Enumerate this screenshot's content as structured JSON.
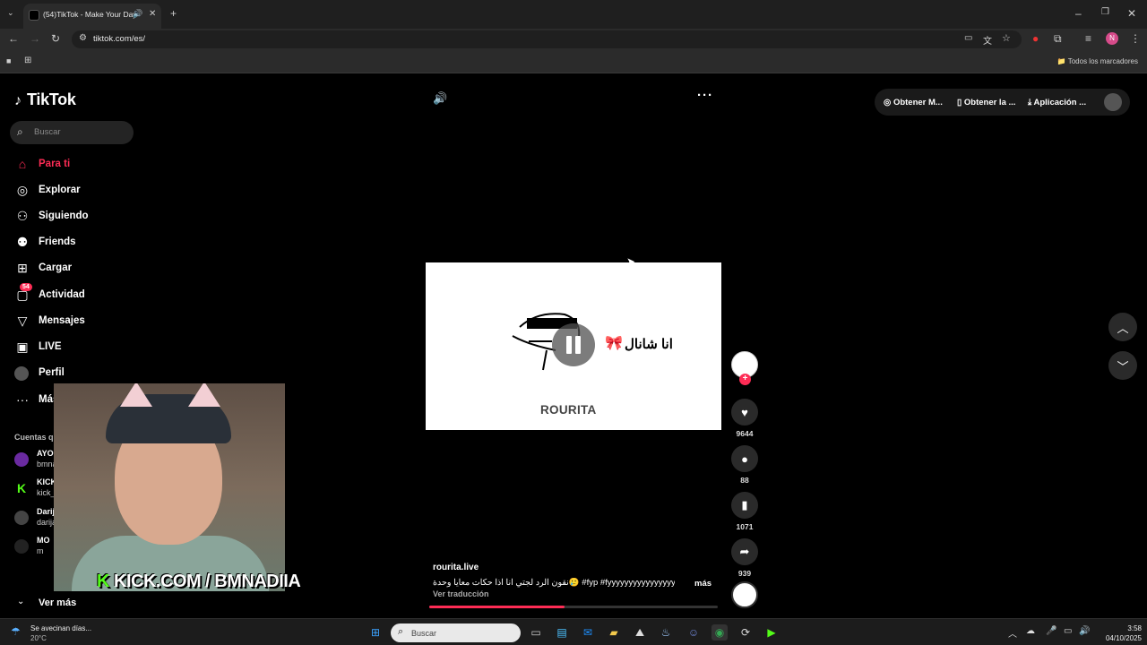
{
  "browser": {
    "tab_title": "(54)TikTok - Make Your Day",
    "url": "tiktok.com/es/",
    "bookmarks_label": "Todos los marcadores"
  },
  "tiktok": {
    "logo": "TikTok",
    "search_placeholder": "Buscar",
    "nav": [
      {
        "label": "Para ti",
        "icon": "home-icon"
      },
      {
        "label": "Explorar",
        "icon": "compass-icon"
      },
      {
        "label": "Siguiendo",
        "icon": "following-icon"
      },
      {
        "label": "Friends",
        "icon": "friends-icon"
      },
      {
        "label": "Cargar",
        "icon": "upload-icon"
      },
      {
        "label": "Actividad",
        "icon": "activity-icon",
        "badge": "54"
      },
      {
        "label": "Mensajes",
        "icon": "messages-icon"
      },
      {
        "label": "LIVE",
        "icon": "live-icon"
      },
      {
        "label": "Perfil",
        "icon": "profile-icon"
      },
      {
        "label": "Más",
        "icon": "more-icon"
      }
    ],
    "following_title": "Cuentas que sigues",
    "following": [
      {
        "name": "AYOUA GANG",
        "handle": "bmnadiia_fan"
      },
      {
        "name": "KICK__Cl",
        "handle": "kick_cli"
      },
      {
        "name": "DarijaM",
        "handle": "darija"
      },
      {
        "name": "MO",
        "handle": "m"
      }
    ],
    "see_more": "Ver más",
    "top_actions": [
      "Obtener M...",
      "Obtener la ...",
      "Aplicación ..."
    ],
    "video": {
      "meme_text": "انا شانال",
      "meme_brand": "ROURITA",
      "username": "rourita.live",
      "caption": "نقون الرد لجتي انا اذا حكات معايا وحدة🥲 #fyp #fyyyyyyyyyyyyyyyy ...",
      "more": "más",
      "translate": "Ver traducción",
      "progress": 0.47
    },
    "stats": {
      "likes": "9644",
      "comments": "88",
      "saves": "1071",
      "shares": "939"
    }
  },
  "overlay": {
    "kick_text": "KICK.COM / BMNADIIA",
    "kick_k": "K"
  },
  "taskbar": {
    "weather_line1": "Se avecinan días...",
    "weather_line2": "20°C",
    "search_placeholder": "Buscar",
    "time": "3:58",
    "date": "04/10/2025"
  }
}
